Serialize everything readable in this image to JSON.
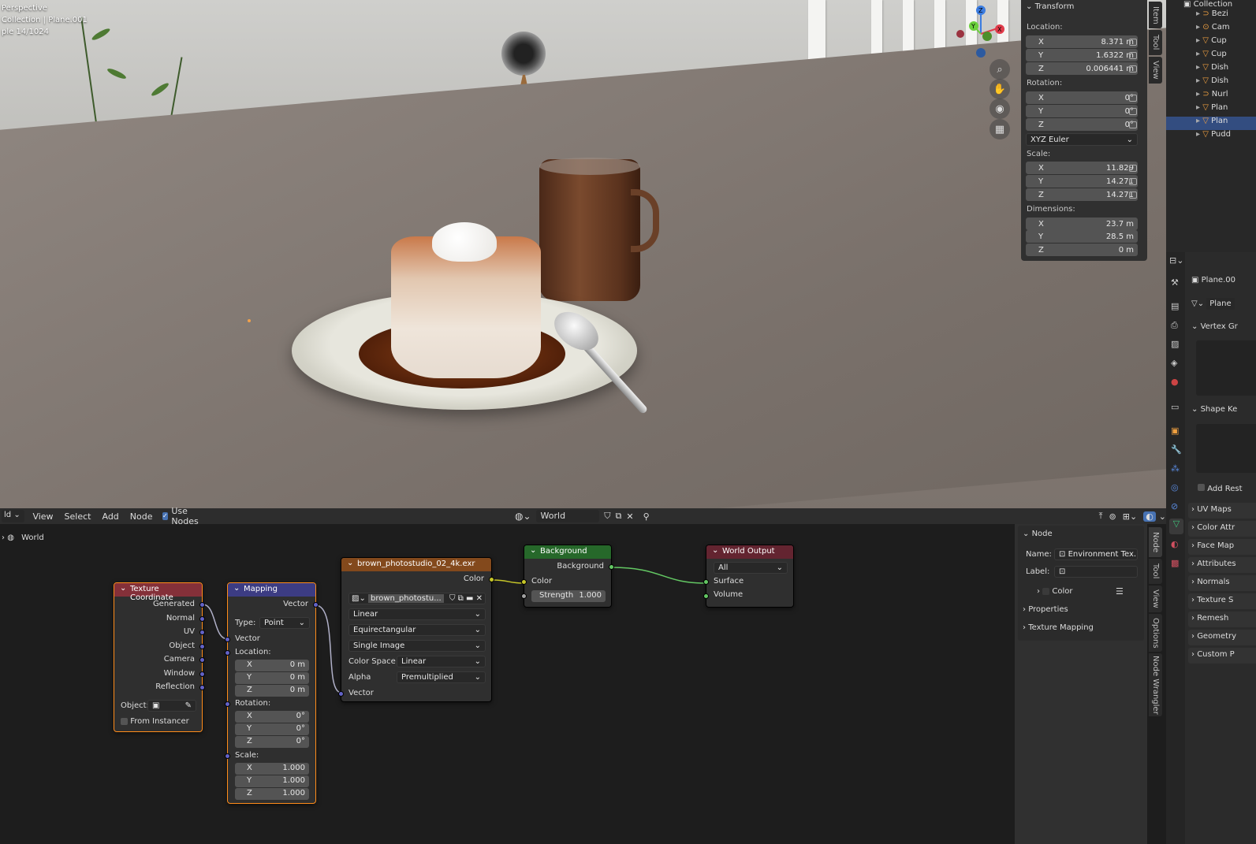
{
  "viewport": {
    "info_line1": "Perspective",
    "info_line2": "Collection | Plane.001",
    "info_line3": "ple 14/1024"
  },
  "gizmo": {
    "z": "Z",
    "y": "Y",
    "x": "X"
  },
  "npanel": {
    "title": "Transform",
    "location_label": "Location:",
    "loc_x": "8.371 m",
    "loc_y": "1.6322 m",
    "loc_z": "0.006441 m",
    "rotation_label": "Rotation:",
    "rot_x": "0°",
    "rot_y": "0°",
    "rot_z": "0°",
    "rotation_mode": "XYZ Euler",
    "scale_label": "Scale:",
    "scale_x": "11.829",
    "scale_y": "14.271",
    "scale_z": "14.271",
    "dimensions_label": "Dimensions:",
    "dim_x": "23.7 m",
    "dim_y": "28.5 m",
    "dim_z": "0 m",
    "axis_x": "X",
    "axis_y": "Y",
    "axis_z": "Z"
  },
  "viewport_tabs": [
    "Item",
    "Tool",
    "View"
  ],
  "outliner": {
    "items": [
      "Collection",
      "Bezi",
      "Cam",
      "Cup",
      "Cup",
      "Dish",
      "Dish",
      "Nurl",
      "Plan",
      "Plan",
      "Pudd"
    ]
  },
  "properties": {
    "object_name": "Plane.00",
    "data_name": "Plane",
    "vertex_groups": "Vertex Gr",
    "shape_keys": "Shape Ke",
    "add_rest": "Add Rest",
    "sections": [
      "UV Maps",
      "Color Attr",
      "Face Map",
      "Attributes",
      "Normals",
      "Texture S",
      "Remesh",
      "Geometry",
      "Custom P"
    ]
  },
  "node_header": {
    "editor": "ld",
    "menus": [
      "View",
      "Select",
      "Add",
      "Node"
    ],
    "use_nodes": "Use Nodes",
    "world_name": "World"
  },
  "breadcrumb": "World",
  "nodes": {
    "texcoord": {
      "title": "Texture Coordinate",
      "outputs": [
        "Generated",
        "Normal",
        "UV",
        "Object",
        "Camera",
        "Window",
        "Reflection"
      ],
      "object_label": "Object:",
      "from_instancer": "From Instancer"
    },
    "mapping": {
      "title": "Mapping",
      "vector_out": "Vector",
      "type_label": "Type:",
      "type_value": "Point",
      "vector_in": "Vector",
      "location": "Location:",
      "rotation": "Rotation:",
      "scale": "Scale:",
      "loc": [
        "0 m",
        "0 m",
        "0 m"
      ],
      "rot": [
        "0°",
        "0°",
        "0°"
      ],
      "scl": [
        "1.000",
        "1.000",
        "1.000"
      ],
      "axes": [
        "X",
        "Y",
        "Z"
      ]
    },
    "envtex": {
      "title": "brown_photostudio_02_4k.exr",
      "color_out": "Color",
      "image": "brown_photostu...",
      "interp": "Linear",
      "proj": "Equirectangular",
      "source": "Single Image",
      "cs_label": "Color Space",
      "cs_value": "Linear",
      "alpha_label": "Alpha",
      "alpha_value": "Premultiplied",
      "vector_in": "Vector"
    },
    "background": {
      "title": "Background",
      "out": "Background",
      "color_in": "Color",
      "strength_label": "Strength",
      "strength_value": "1.000"
    },
    "output": {
      "title": "World Output",
      "target": "All",
      "surface": "Surface",
      "volume": "Volume"
    }
  },
  "node_sidebar": {
    "section": "Node",
    "name_label": "Name:",
    "name_value": "Environment Tex...",
    "label_label": "Label:",
    "color": "Color",
    "properties": "Properties",
    "texture_mapping": "Texture Mapping"
  },
  "node_tabs": [
    "Node",
    "Tool",
    "View",
    "Options",
    "Node Wrangler"
  ],
  "colors": {
    "texcoord_head": "#843039",
    "mapping_head": "#3c3c83",
    "envtex_head": "#83491c",
    "bg_head": "#26682a",
    "out_head": "#632430",
    "accent": "#4772b3"
  }
}
